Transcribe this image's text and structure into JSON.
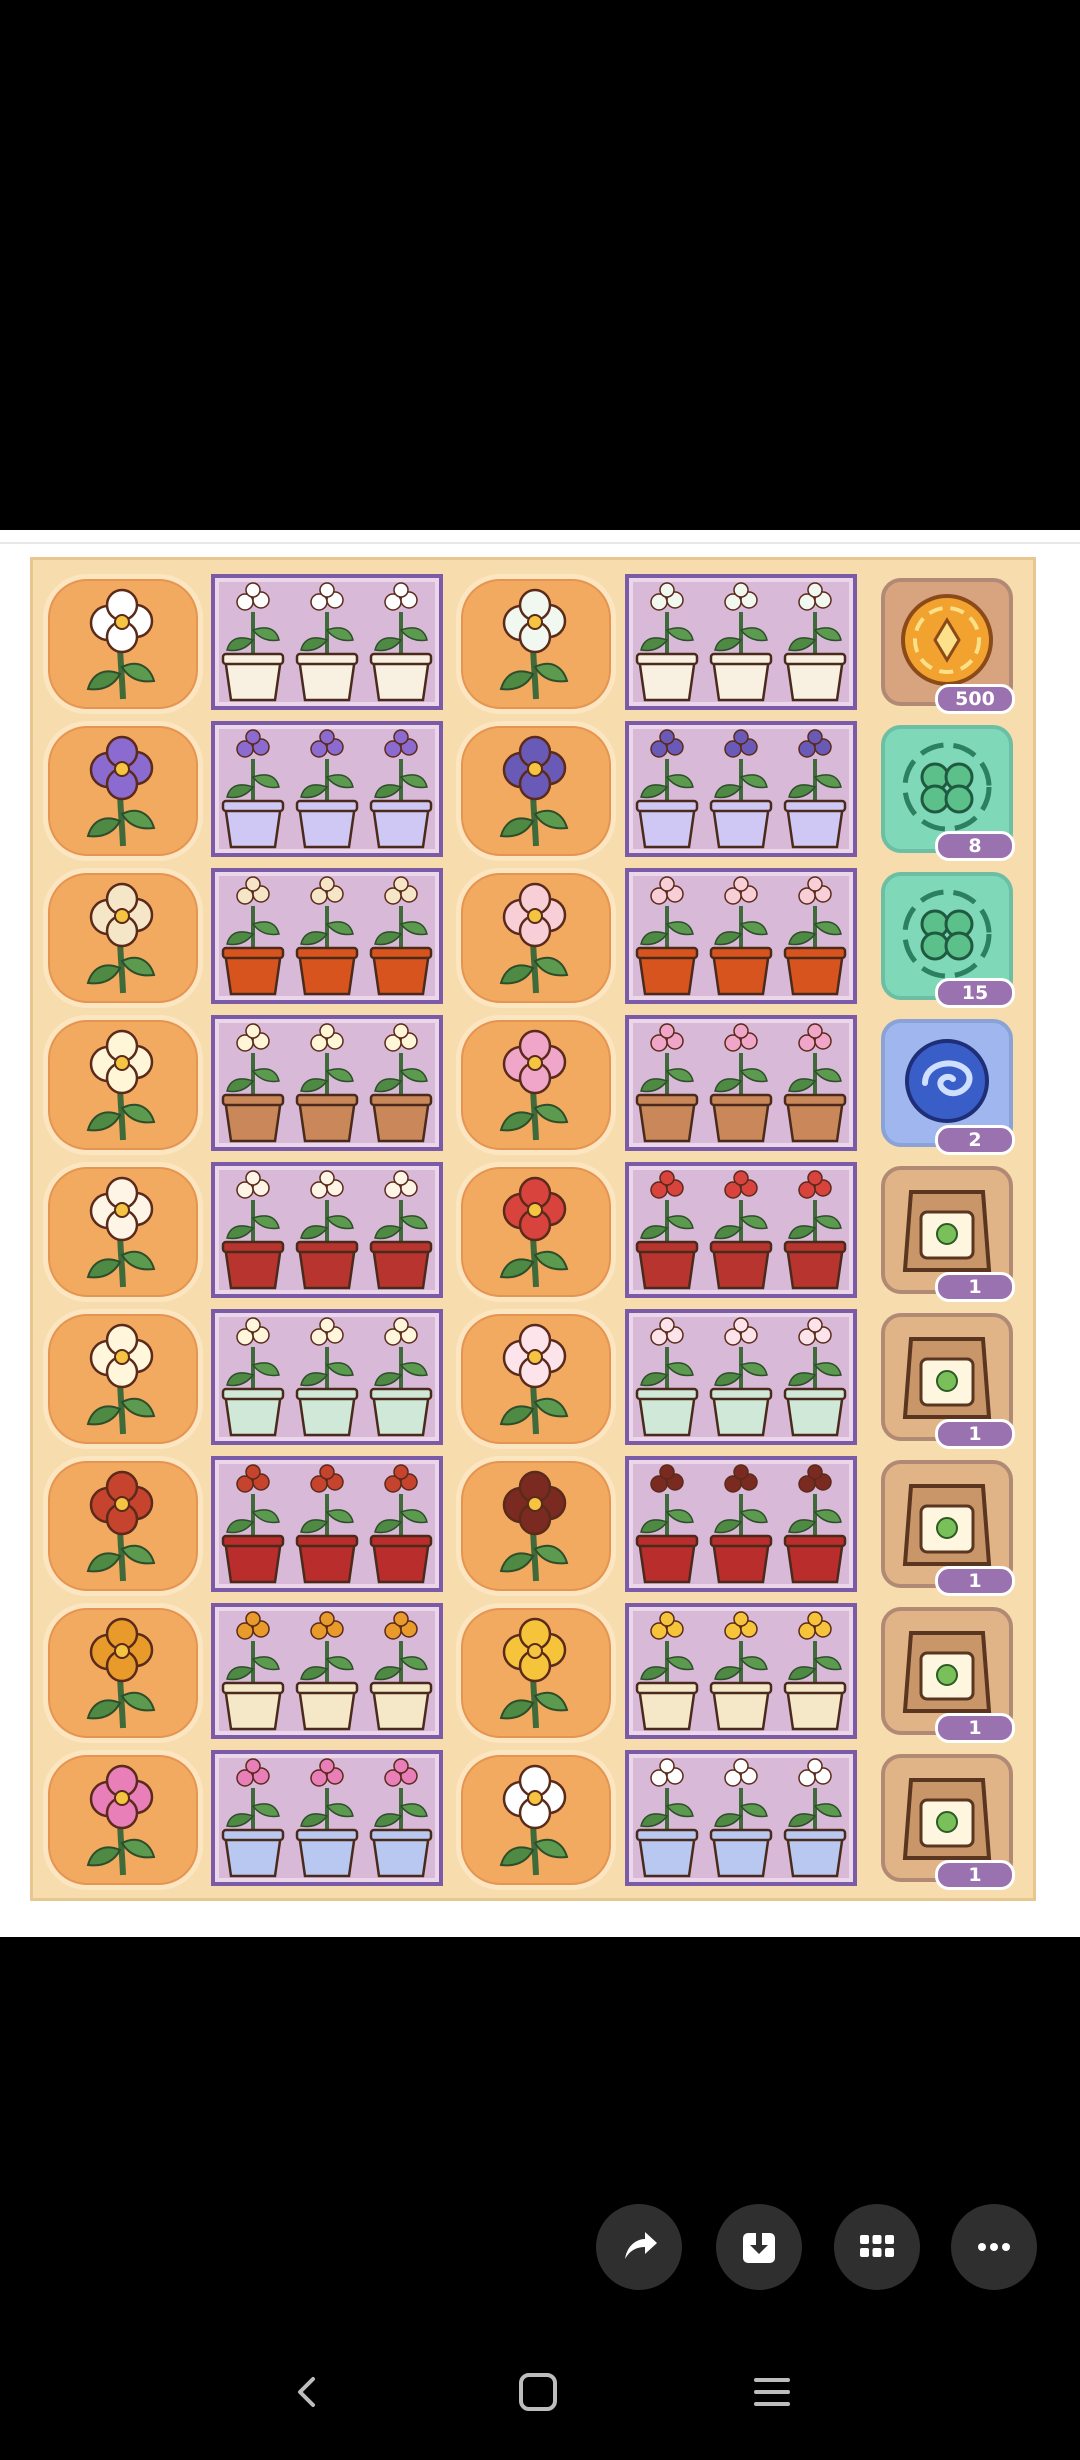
{
  "board": {
    "rows": [
      {
        "flower_a": "white-blossom-icon",
        "pots_a": "cat-face-pot-icon",
        "flower_b": "white-hyacinth-icon",
        "pots_b": "cat-face-pot-icon",
        "item": {
          "icon": "gold-coin-icon",
          "count": "500",
          "style": "coin"
        }
      },
      {
        "flower_a": "purple-bellflower-icon",
        "pots_a": "glass-cube-pot-icon",
        "flower_b": "purple-hyacinth-icon",
        "pots_b": "glass-cube-pot-icon",
        "item": {
          "icon": "clover-token-icon",
          "count": "8",
          "style": "mint"
        }
      },
      {
        "flower_a": "bird-of-paradise-icon",
        "pots_a": "red-gold-pot-icon",
        "flower_b": "pink-lily-icon",
        "pots_b": "red-gold-pot-icon",
        "item": {
          "icon": "clover-token-icon",
          "count": "15",
          "style": "mint"
        }
      },
      {
        "flower_a": "white-lily-icon",
        "pots_a": "terracotta-pot-icon",
        "flower_b": "pink-star-lily-icon",
        "pots_b": "terracotta-pot-icon",
        "item": {
          "icon": "swirl-token-icon",
          "count": "2",
          "style": "cosmic"
        }
      },
      {
        "flower_a": "white-carnation-icon",
        "pots_a": "red-pot-icon",
        "flower_b": "red-heliconia-icon",
        "pots_b": "red-pot-icon",
        "item": {
          "icon": "fertilizer-bottle-icon",
          "count": "1",
          "style": "bag"
        }
      },
      {
        "flower_a": "white-plumeria-icon",
        "pots_a": "mint-patterned-pot-icon",
        "flower_b": "pink-hyacinth-icon",
        "pots_b": "mint-patterned-pot-icon",
        "item": {
          "icon": "mystery-seed-bag-icon",
          "count": "1",
          "style": "bag"
        }
      },
      {
        "flower_a": "red-maple-branch-icon",
        "pots_a": "red-round-pot-icon",
        "flower_b": "dark-lily-icon",
        "pots_b": "red-round-pot-icon",
        "item": {
          "icon": "seed-bag-icon",
          "count": "1",
          "style": "bag"
        }
      },
      {
        "flower_a": "orange-marigold-icon",
        "pots_a": "bow-pot-icon",
        "flower_b": "yellow-jasmine-icon",
        "pots_b": "bow-pot-icon",
        "item": {
          "icon": "seed-bag-corn-icon",
          "count": "1",
          "style": "bag"
        }
      },
      {
        "flower_a": "pink-chrysanthemum-icon",
        "pots_a": "blue-stripe-pot-icon",
        "flower_b": "white-orchid-icon",
        "pots_b": "blue-stripe-pot-icon",
        "item": {
          "icon": "seed-bag-flower-icon",
          "count": "1",
          "style": "bag"
        }
      }
    ],
    "flower_colors_a": [
      "#ffffff",
      "#8c6bd0",
      "#f6e6c8",
      "#fff6d8",
      "#fff5e6",
      "#fff6dc",
      "#c6432d",
      "#e89a2a",
      "#e87fb8"
    ],
    "flower_colors_b": [
      "#f0f8f0",
      "#6a5ab8",
      "#f8cfd7",
      "#f0a6c8",
      "#d8433d",
      "#fde3ea",
      "#7a2a20",
      "#f6c43a",
      "#ffffff"
    ],
    "pot_colors_a": [
      "#f8f1e2",
      "#cfc8f4",
      "#d8541f",
      "#c9875a",
      "#b8342e",
      "#cfe8d8",
      "#b92d2d",
      "#f5e8c8",
      "#b8c8f0"
    ],
    "pot_colors_b": [
      "#f8f1e2",
      "#cfc8f4",
      "#d8541f",
      "#c9875a",
      "#b8342e",
      "#cfe8d8",
      "#b92d2d",
      "#f5e8c8",
      "#b8c8f0"
    ]
  },
  "actions": [
    {
      "icon": "share-icon"
    },
    {
      "icon": "download-icon"
    },
    {
      "icon": "apps-grid-icon"
    },
    {
      "icon": "more-icon"
    }
  ],
  "nav": [
    {
      "icon": "back-icon"
    },
    {
      "icon": "home-icon"
    },
    {
      "icon": "recents-icon"
    }
  ]
}
